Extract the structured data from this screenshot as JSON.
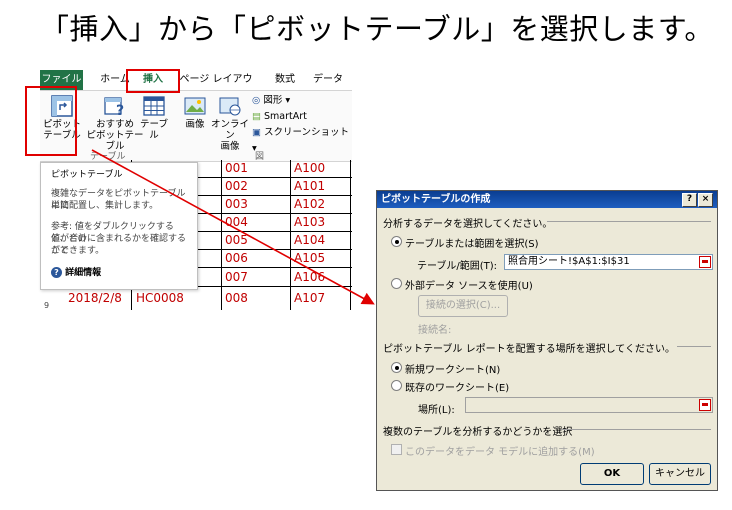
{
  "caption": "「挿入」から「ピボットテーブル」を選択します。",
  "ribbon": {
    "tabs": {
      "file": "ファイル",
      "home": "ホーム",
      "insert": "挿入",
      "layout": "ページ レイアウト",
      "formulas": "数式",
      "data": "データ"
    },
    "pivot_label_1": "ピボット",
    "pivot_label_2": "テーブル",
    "recommended_label_1": "おすすめ",
    "recommended_label_2": "ピボットテーブル",
    "table_label": "テーブル",
    "image_label": "画像",
    "online_label_1": "オンライン",
    "online_label_2": "画像",
    "shapes_label": "図形",
    "smartart_label": "SmartArt",
    "screenshot_label": "スクリーンショット",
    "group_label": "テーブル",
    "group_label_fig": "図"
  },
  "sheet": {
    "rows": [
      {
        "code": "001",
        "id": "A100"
      },
      {
        "code": "002",
        "id": "A101"
      },
      {
        "code": "003",
        "id": "A102"
      },
      {
        "code": "004",
        "id": "A103"
      },
      {
        "code": "005",
        "id": "A104"
      },
      {
        "code": "006",
        "id": "A105"
      },
      {
        "code": "007",
        "id": "A106"
      },
      {
        "date": "2018/2/8",
        "code": "HC0008",
        "num": "008",
        "id": "A107"
      }
    ],
    "row_number": "9"
  },
  "tooltip": {
    "title": "ピボットテーブル",
    "line1": "複雑なデータをピボットテーブルに簡",
    "line2": "単に配置し、集計します。",
    "line3": "参考: 値をダブルクリックすると、どの",
    "line4": "値が合計に含まれるかを確認すること",
    "line5": "ができます。",
    "more": "詳細情報"
  },
  "dialog": {
    "title": "ピボットテーブルの作成",
    "help": "?",
    "close": "×",
    "section1": "分析するデータを選択してください。",
    "radio_table_range": "テーブルまたは範囲を選択(S)",
    "table_range_label": "テーブル/範囲(T):",
    "table_range_value": "照合用シート!$A$1:$I$31",
    "radio_external": "外部データ ソースを使用(U)",
    "connection_button": "接続の選択(C)...",
    "connection_name_label": "接続名:",
    "section2": "ピボットテーブル レポートを配置する場所を選択してください。",
    "radio_new_sheet": "新規ワークシート(N)",
    "radio_existing_sheet": "既存のワークシート(E)",
    "location_label": "場所(L):",
    "section3": "複数のテーブルを分析するかどうかを選択",
    "checkbox_data_model": "このデータをデータ モデルに追加する(M)",
    "ok": "OK",
    "cancel": "キャンセル"
  },
  "colors": {
    "highlight": "#e00000",
    "excel_green": "#217346",
    "cell_text": "#c00000",
    "arrow": "#e00000"
  }
}
